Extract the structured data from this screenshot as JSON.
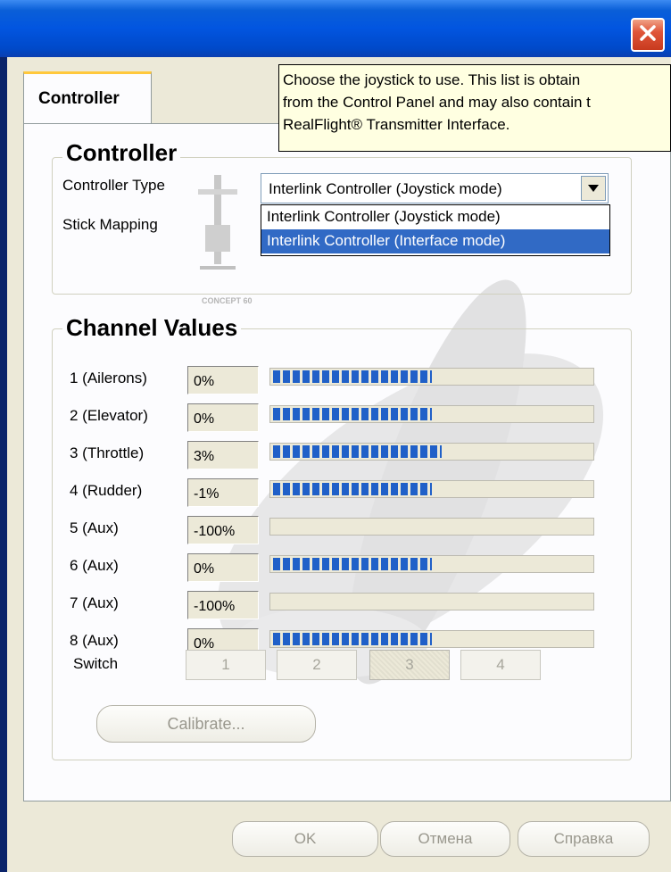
{
  "window": {
    "close_icon": "close-icon",
    "tab_label": "Controller"
  },
  "tooltip": {
    "lines": [
      "Choose the joystick to use.  This list is obtain",
      "from the Control Panel and may also contain t",
      "RealFlight® Transmitter Interface."
    ]
  },
  "controller_group": {
    "title": "Controller",
    "controller_type_label": "Controller Type",
    "stick_mapping_label": "Stick Mapping",
    "combo_value": "Interlink Controller (Joystick mode)",
    "options": [
      "Interlink Controller (Joystick mode)",
      "Interlink Controller (Interface mode)"
    ],
    "selected_option_index": 1,
    "image_caption": "CONCEPT 60"
  },
  "channels_group": {
    "title": "Channel Values",
    "channels": [
      {
        "label": "1 (Ailerons)",
        "value": "0%",
        "level": 0.5
      },
      {
        "label": "2 (Elevator)",
        "value": "0%",
        "level": 0.5
      },
      {
        "label": "3 (Throttle)",
        "value": "3%",
        "level": 0.53
      },
      {
        "label": "4 (Rudder)",
        "value": "-1%",
        "level": 0.5
      },
      {
        "label": "5 (Aux)",
        "value": "-100%",
        "level": 0.0
      },
      {
        "label": "6 (Aux)",
        "value": "0%",
        "level": 0.5
      },
      {
        "label": "7 (Aux)",
        "value": "-100%",
        "level": 0.0
      },
      {
        "label": "8 (Aux)",
        "value": "0%",
        "level": 0.5
      }
    ],
    "switch_label": "Switch",
    "switches": [
      "1",
      "2",
      "3",
      "4"
    ],
    "pressed_switch_index": 2,
    "calibrate_label": "Calibrate..."
  },
  "footer": {
    "ok_label": "OK",
    "cancel_label": "Отмена",
    "help_label": "Справка"
  },
  "colors": {
    "titlebar": "#0255e0",
    "selection": "#316ac5",
    "bar_fill": "#2060c8",
    "tooltip_bg": "#ffffe1",
    "dialog_bg": "#ece9d8"
  }
}
